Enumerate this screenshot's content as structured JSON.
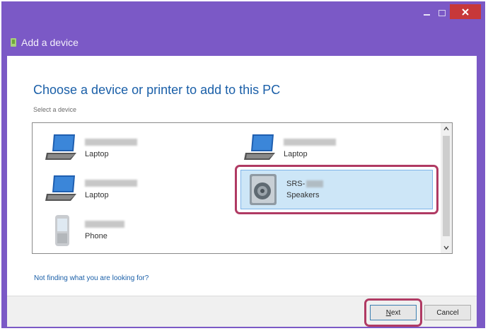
{
  "window": {
    "title": "Add a device",
    "accent_color": "#7b59c6",
    "close_color": "#c7383a"
  },
  "main": {
    "heading": "Choose a device or printer to add to this PC",
    "subheading": "Select a device",
    "help_link": "Not finding what you are looking for?"
  },
  "devices": [
    {
      "name": "",
      "type": "Laptop",
      "icon": "laptop-icon"
    },
    {
      "name": "",
      "type": "Laptop",
      "icon": "laptop-icon"
    },
    {
      "name": "SRS-",
      "type": "Speakers",
      "icon": "speaker-icon",
      "selected": true
    },
    {
      "name": "",
      "type": "Laptop",
      "icon": "laptop-icon"
    },
    {
      "name": "",
      "type": "Phone",
      "icon": "phone-icon"
    }
  ],
  "footer": {
    "next_prefix": "N",
    "next_rest": "ext",
    "cancel_label": "Cancel"
  },
  "highlight_color": "#b03a63"
}
